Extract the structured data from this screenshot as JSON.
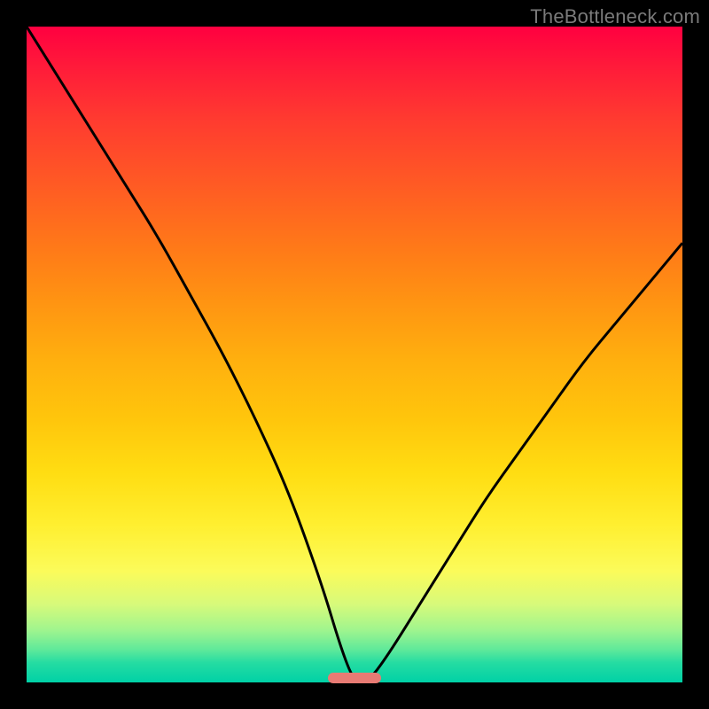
{
  "watermark_text": "TheBottleneck.com",
  "chart_data": {
    "type": "line",
    "title": "",
    "xlabel": "",
    "ylabel": "",
    "xlim": [
      0,
      100
    ],
    "ylim": [
      0,
      100
    ],
    "grid": false,
    "legend": false,
    "background_gradient": {
      "top": "#ff0040",
      "bottom": "#00d1a6",
      "description": "vertical rainbow gradient red→orange→yellow→green"
    },
    "series": [
      {
        "name": "bottleneck-curve",
        "color": "#000000",
        "x": [
          0,
          5,
          10,
          15,
          20,
          25,
          30,
          35,
          40,
          45,
          48,
          50,
          52,
          55,
          60,
          65,
          70,
          75,
          80,
          85,
          90,
          95,
          100
        ],
        "values": [
          100,
          92,
          84,
          76,
          68,
          59,
          50,
          40,
          29,
          15,
          5,
          0,
          0,
          4,
          12,
          20,
          28,
          35,
          42,
          49,
          55,
          61,
          67
        ]
      }
    ],
    "marker": {
      "name": "optimum-marker",
      "x_center": 50,
      "x_width": 8,
      "color": "#e87b74"
    }
  }
}
